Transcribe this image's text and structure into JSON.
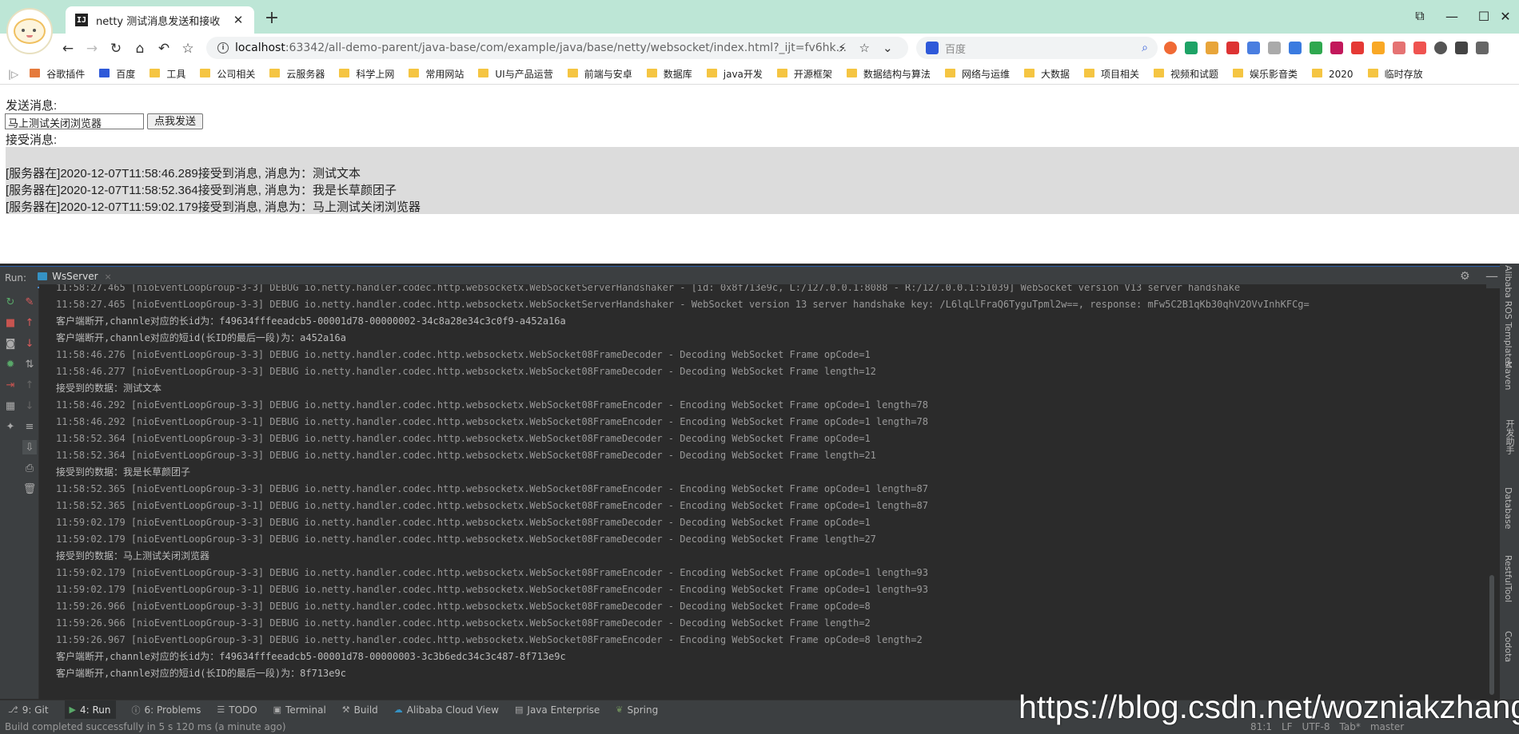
{
  "browser": {
    "tab_title": "netty 测试消息发送和接收",
    "tab_favicon": "IJ",
    "close_tab_glyph": "✕",
    "new_tab_glyph": "+",
    "url_host": "localhost",
    "url_rest": ":63342/all-demo-parent/java-base/com/example/java/base/netty/websocket/index.html?_ijt=fv6hk...",
    "search_placeholder": "百度",
    "window_buttons": [
      "⧉",
      "—",
      "☐",
      "✕"
    ],
    "bookmarks": [
      "谷歌插件",
      "百度",
      "工具",
      "公司相关",
      "云服务器",
      "科学上网",
      "常用网站",
      "UI与产品运营",
      "前端与安卓",
      "数据库",
      "java开发",
      "开源框架",
      "数据结构与算法",
      "网络与运维",
      "大数据",
      "项目相关",
      "视频和试题",
      "娱乐影音类",
      "2020",
      "临时存放"
    ],
    "accent_color": "#bde6d6"
  },
  "page": {
    "send_label": "发送消息:",
    "input_value": "马上测试关闭浏览器",
    "send_button": "点我发送",
    "receive_label": "接受消息:",
    "messages": [
      "[服务器在]2020-12-07T11:58:46.289接受到消息, 消息为：测试文本",
      "[服务器在]2020-12-07T11:58:52.364接受到消息, 消息为：我是长草颜团子",
      "[服务器在]2020-12-07T11:59:02.179接受到消息, 消息为：马上测试关闭浏览器"
    ]
  },
  "ide": {
    "run_label": "Run:",
    "run_tab": "WsServer",
    "console_lines": [
      {
        "text": "11:58:27.465 [nioEventLoopGroup-3-3] DEBUG io.netty.handler.codec.http.websocketx.WebSocketServerHandshaker - [id: 0x8f713e9c, L:/127.0.0.1:8088 - R:/127.0.0.1:51039] WebSocket version V13 server handshake",
        "debug": true
      },
      {
        "text": "11:58:27.465 [nioEventLoopGroup-3-3] DEBUG io.netty.handler.codec.http.websocketx.WebSocketServerHandshaker - WebSocket version 13 server handshake key: /L6lqLlFraQ6TyguTpml2w==, response: mFw5C2B1qKb30qhV2OVvInhKFCg=",
        "debug": true
      },
      {
        "text": "客户端断开,channle对应的长id为：f49634fffeeadcb5-00001d78-00000002-34c8a28e34c3c0f9-a452a16a",
        "debug": false
      },
      {
        "text": "客户端断开,channle对应的短id(长ID的最后一段)为：a452a16a",
        "debug": false
      },
      {
        "text": "11:58:46.276 [nioEventLoopGroup-3-3] DEBUG io.netty.handler.codec.http.websocketx.WebSocket08FrameDecoder - Decoding WebSocket Frame opCode=1",
        "debug": true
      },
      {
        "text": "11:58:46.277 [nioEventLoopGroup-3-3] DEBUG io.netty.handler.codec.http.websocketx.WebSocket08FrameDecoder - Decoding WebSocket Frame length=12",
        "debug": true
      },
      {
        "text": "接受到的数据：测试文本",
        "debug": false
      },
      {
        "text": "11:58:46.292 [nioEventLoopGroup-3-3] DEBUG io.netty.handler.codec.http.websocketx.WebSocket08FrameEncoder - Encoding WebSocket Frame opCode=1 length=78",
        "debug": true
      },
      {
        "text": "11:58:46.292 [nioEventLoopGroup-3-1] DEBUG io.netty.handler.codec.http.websocketx.WebSocket08FrameEncoder - Encoding WebSocket Frame opCode=1 length=78",
        "debug": true
      },
      {
        "text": "11:58:52.364 [nioEventLoopGroup-3-3] DEBUG io.netty.handler.codec.http.websocketx.WebSocket08FrameDecoder - Decoding WebSocket Frame opCode=1",
        "debug": true
      },
      {
        "text": "11:58:52.364 [nioEventLoopGroup-3-3] DEBUG io.netty.handler.codec.http.websocketx.WebSocket08FrameDecoder - Decoding WebSocket Frame length=21",
        "debug": true
      },
      {
        "text": "接受到的数据：我是长草颜团子",
        "debug": false
      },
      {
        "text": "11:58:52.365 [nioEventLoopGroup-3-3] DEBUG io.netty.handler.codec.http.websocketx.WebSocket08FrameEncoder - Encoding WebSocket Frame opCode=1 length=87",
        "debug": true
      },
      {
        "text": "11:58:52.365 [nioEventLoopGroup-3-1] DEBUG io.netty.handler.codec.http.websocketx.WebSocket08FrameEncoder - Encoding WebSocket Frame opCode=1 length=87",
        "debug": true
      },
      {
        "text": "11:59:02.179 [nioEventLoopGroup-3-3] DEBUG io.netty.handler.codec.http.websocketx.WebSocket08FrameDecoder - Decoding WebSocket Frame opCode=1",
        "debug": true
      },
      {
        "text": "11:59:02.179 [nioEventLoopGroup-3-3] DEBUG io.netty.handler.codec.http.websocketx.WebSocket08FrameDecoder - Decoding WebSocket Frame length=27",
        "debug": true
      },
      {
        "text": "接受到的数据：马上测试关闭浏览器",
        "debug": false
      },
      {
        "text": "11:59:02.179 [nioEventLoopGroup-3-3] DEBUG io.netty.handler.codec.http.websocketx.WebSocket08FrameEncoder - Encoding WebSocket Frame opCode=1 length=93",
        "debug": true
      },
      {
        "text": "11:59:02.179 [nioEventLoopGroup-3-1] DEBUG io.netty.handler.codec.http.websocketx.WebSocket08FrameEncoder - Encoding WebSocket Frame opCode=1 length=93",
        "debug": true
      },
      {
        "text": "11:59:26.966 [nioEventLoopGroup-3-3] DEBUG io.netty.handler.codec.http.websocketx.WebSocket08FrameDecoder - Decoding WebSocket Frame opCode=8",
        "debug": true
      },
      {
        "text": "11:59:26.966 [nioEventLoopGroup-3-3] DEBUG io.netty.handler.codec.http.websocketx.WebSocket08FrameDecoder - Decoding WebSocket Frame length=2",
        "debug": true
      },
      {
        "text": "11:59:26.967 [nioEventLoopGroup-3-3] DEBUG io.netty.handler.codec.http.websocketx.WebSocket08FrameEncoder - Encoding WebSocket Frame opCode=8 length=2",
        "debug": true
      },
      {
        "text": "客户端断开,channle对应的长id为：f49634fffeeadcb5-00001d78-00000003-3c3b6edc34c3c487-8f713e9c",
        "debug": false
      },
      {
        "text": "客户端断开,channle对应的短id(长ID的最后一段)为：8f713e9c",
        "debug": false
      }
    ],
    "right_tools": [
      "Alibaba ROS Templates",
      "Maven",
      "开发助手",
      "Database",
      "RestfulTool",
      "Codota"
    ],
    "bottom_tabs": [
      {
        "icon": "branch-icon",
        "label": "9: Git"
      },
      {
        "icon": "run-icon",
        "label": "4: Run"
      },
      {
        "icon": "problems-icon",
        "label": "6: Problems"
      },
      {
        "icon": "todo-icon",
        "label": "TODO"
      },
      {
        "icon": "terminal-icon",
        "label": "Terminal"
      },
      {
        "icon": "build-icon",
        "label": "Build"
      },
      {
        "icon": "cloud-icon",
        "label": "Alibaba Cloud View"
      },
      {
        "icon": "enterprise-icon",
        "label": "Java Enterprise"
      },
      {
        "icon": "spring-icon",
        "label": "Spring"
      }
    ],
    "status_text": "Build completed successfully in 5 s 120 ms (a minute ago)",
    "status_right": [
      "81:1",
      "LF",
      "UTF-8",
      "Tab*",
      "master"
    ]
  },
  "watermark": "https://blog.csdn.net/wozniakzhang"
}
